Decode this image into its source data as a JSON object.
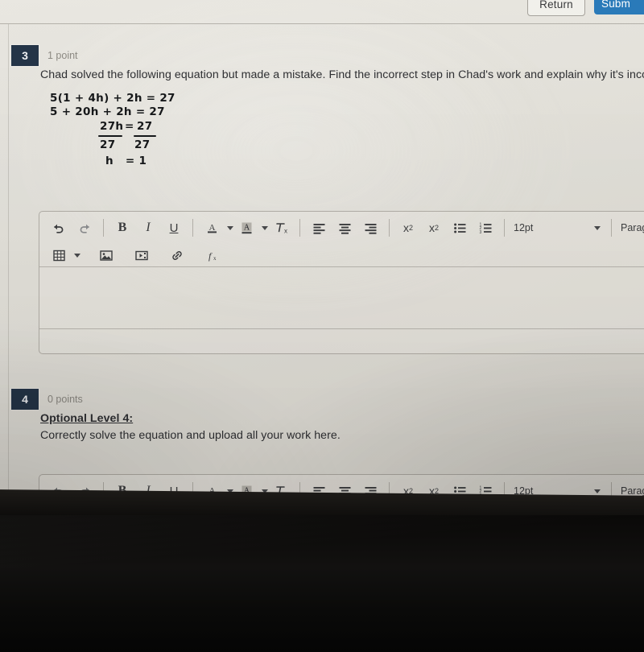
{
  "header": {
    "return_label": "Return",
    "submit_label": "Subm",
    "submit_color": "#2a7ab9"
  },
  "questions": [
    {
      "number": "3",
      "points": "1 point",
      "prompt": "Chad solved the following equation but made a mistake. Find the incorrect step in Chad's work and explain why it's inco",
      "work": {
        "line1": "5(1 + 4h) + 2h = 27",
        "line2": "5 + 20h + 2h = 27",
        "line3_left": "27h",
        "line3_eq": "=",
        "line3_right": "27",
        "line4_left": "27",
        "line4_right": "27",
        "line5": "h   = 1"
      }
    },
    {
      "number": "4",
      "points": "0 points",
      "heading": "Optional Level 4:",
      "prompt": "Correctly solve the equation and upload all your work here."
    }
  ],
  "editor": {
    "icons": {
      "undo": "undo-icon",
      "redo": "redo-icon",
      "bold": "B",
      "italic": "I",
      "underline": "U",
      "text_color": "A",
      "highlight_color": "A",
      "clear_format": "clear-formatting-icon",
      "align_left": "align-left-icon",
      "align_center": "align-center-icon",
      "align_right": "align-right-icon",
      "superscript": "superscript-icon",
      "subscript": "subscript-icon",
      "bullet_list": "bullet-list-icon",
      "numbered_list": "numbered-list-icon",
      "table": "table-icon",
      "image": "image-icon",
      "media": "media-icon",
      "link": "link-icon",
      "equation": "equation-icon"
    },
    "font_size": "12pt",
    "paragraph_style": "Paragraph"
  }
}
